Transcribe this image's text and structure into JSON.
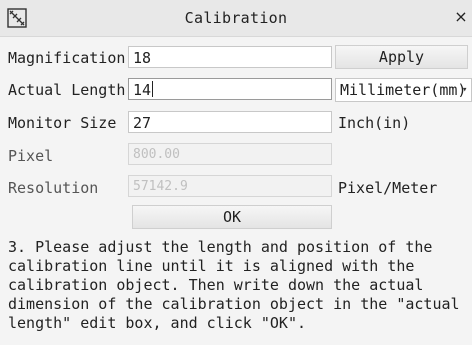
{
  "window": {
    "title": "Calibration",
    "close_glyph": "×",
    "icon": "calibration-app-icon"
  },
  "form": {
    "magnification": {
      "label": "Magnification",
      "value": "18"
    },
    "actual_length": {
      "label": "Actual Length",
      "value": "14"
    },
    "monitor_size": {
      "label": "Monitor Size",
      "value": "27",
      "unit": "Inch(in)"
    },
    "pixel": {
      "label": "Pixel",
      "value": "800.00"
    },
    "resolution": {
      "label": "Resolution",
      "value": "57142.9",
      "unit": "Pixel/Meter"
    },
    "length_unit": {
      "selected": "Millimeter(mm)"
    }
  },
  "buttons": {
    "apply": "Apply",
    "ok": "OK"
  },
  "instructions": {
    "line1": "3. Please adjust the length and position of the",
    "line2": "calibration line until it is aligned with the",
    "line3": "calibration object. Then write down the actual",
    "line4": "dimension of the calibration object in the \"actual",
    "line5": "length\" edit box, and click \"OK\"."
  }
}
